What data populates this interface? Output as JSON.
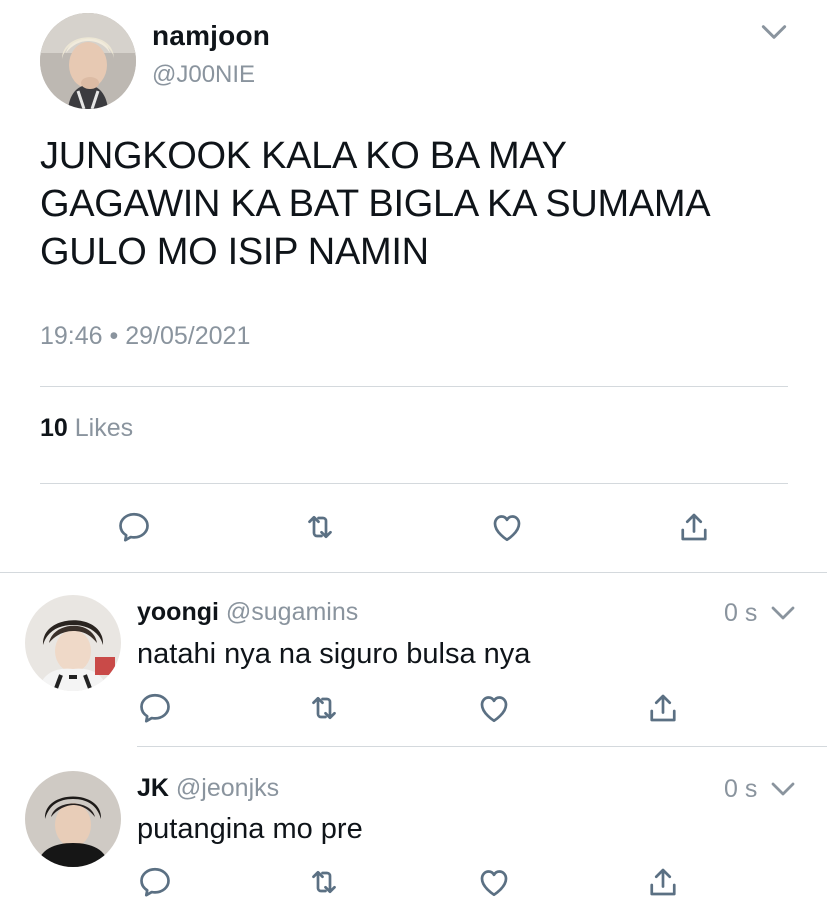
{
  "main_tweet": {
    "name": "namjoon",
    "handle": "@J00NIE",
    "text_lines": [
      "JUNGKOOK KALA KO BA MAY",
      "GAGAWIN KA BAT BIGLA KA SUMAMA",
      "GULO MO ISIP NAMIN"
    ],
    "time": "19:46",
    "separator": "•",
    "date": "29/05/2021",
    "likes_count": "10",
    "likes_label": "Likes",
    "menu_icon": "chevron-down-icon",
    "actions": [
      "reply-icon",
      "retweet-icon",
      "like-icon",
      "share-icon"
    ]
  },
  "replies": [
    {
      "name": "yoongi",
      "handle": "@sugamins",
      "time": "0 s",
      "text": "natahi nya na siguro bulsa nya"
    },
    {
      "name": "JK",
      "handle": "@jeonjks",
      "time": "0 s",
      "text": "putangina mo pre"
    }
  ],
  "colors": {
    "text": "#0f1419",
    "secondary": "#8a949e",
    "icon": "#5b7083",
    "divider": "#d4d9dd"
  }
}
